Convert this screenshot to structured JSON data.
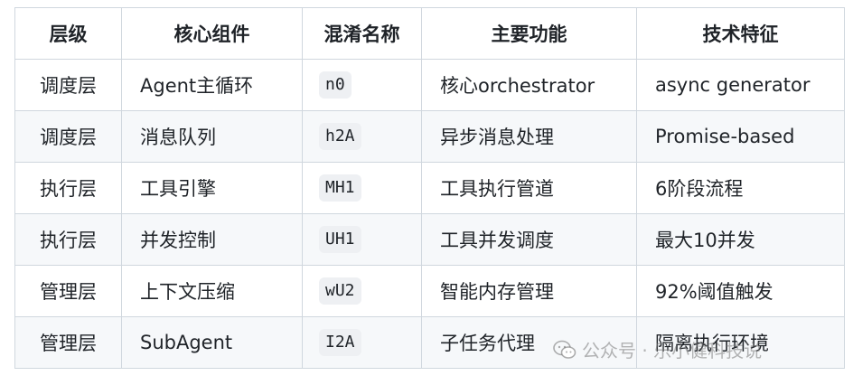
{
  "table": {
    "headers": [
      "层级",
      "核心组件",
      "混淆名称",
      "主要功能",
      "技术特征"
    ],
    "rows": [
      {
        "layer": "调度层",
        "component": "Agent主循环",
        "obfuscated": "n0",
        "function": "核心orchestrator",
        "feature": "async generator"
      },
      {
        "layer": "调度层",
        "component": "消息队列",
        "obfuscated": "h2A",
        "function": "异步消息处理",
        "feature": "Promise-based"
      },
      {
        "layer": "执行层",
        "component": "工具引擎",
        "obfuscated": "MH1",
        "function": "工具执行管道",
        "feature": "6阶段流程"
      },
      {
        "layer": "执行层",
        "component": "并发控制",
        "obfuscated": "UH1",
        "function": "工具并发调度",
        "feature": "最大10并发"
      },
      {
        "layer": "管理层",
        "component": "上下文压缩",
        "obfuscated": "wU2",
        "function": "智能内存管理",
        "feature": "92%阈值触发"
      },
      {
        "layer": "管理层",
        "component": "SubAgent",
        "obfuscated": "I2A",
        "function": "子任务代理",
        "feature": "隔离执行环境"
      }
    ]
  },
  "watermark": {
    "text": "公众号 · 乐小健科技说",
    "icon": "wechat-icon"
  }
}
